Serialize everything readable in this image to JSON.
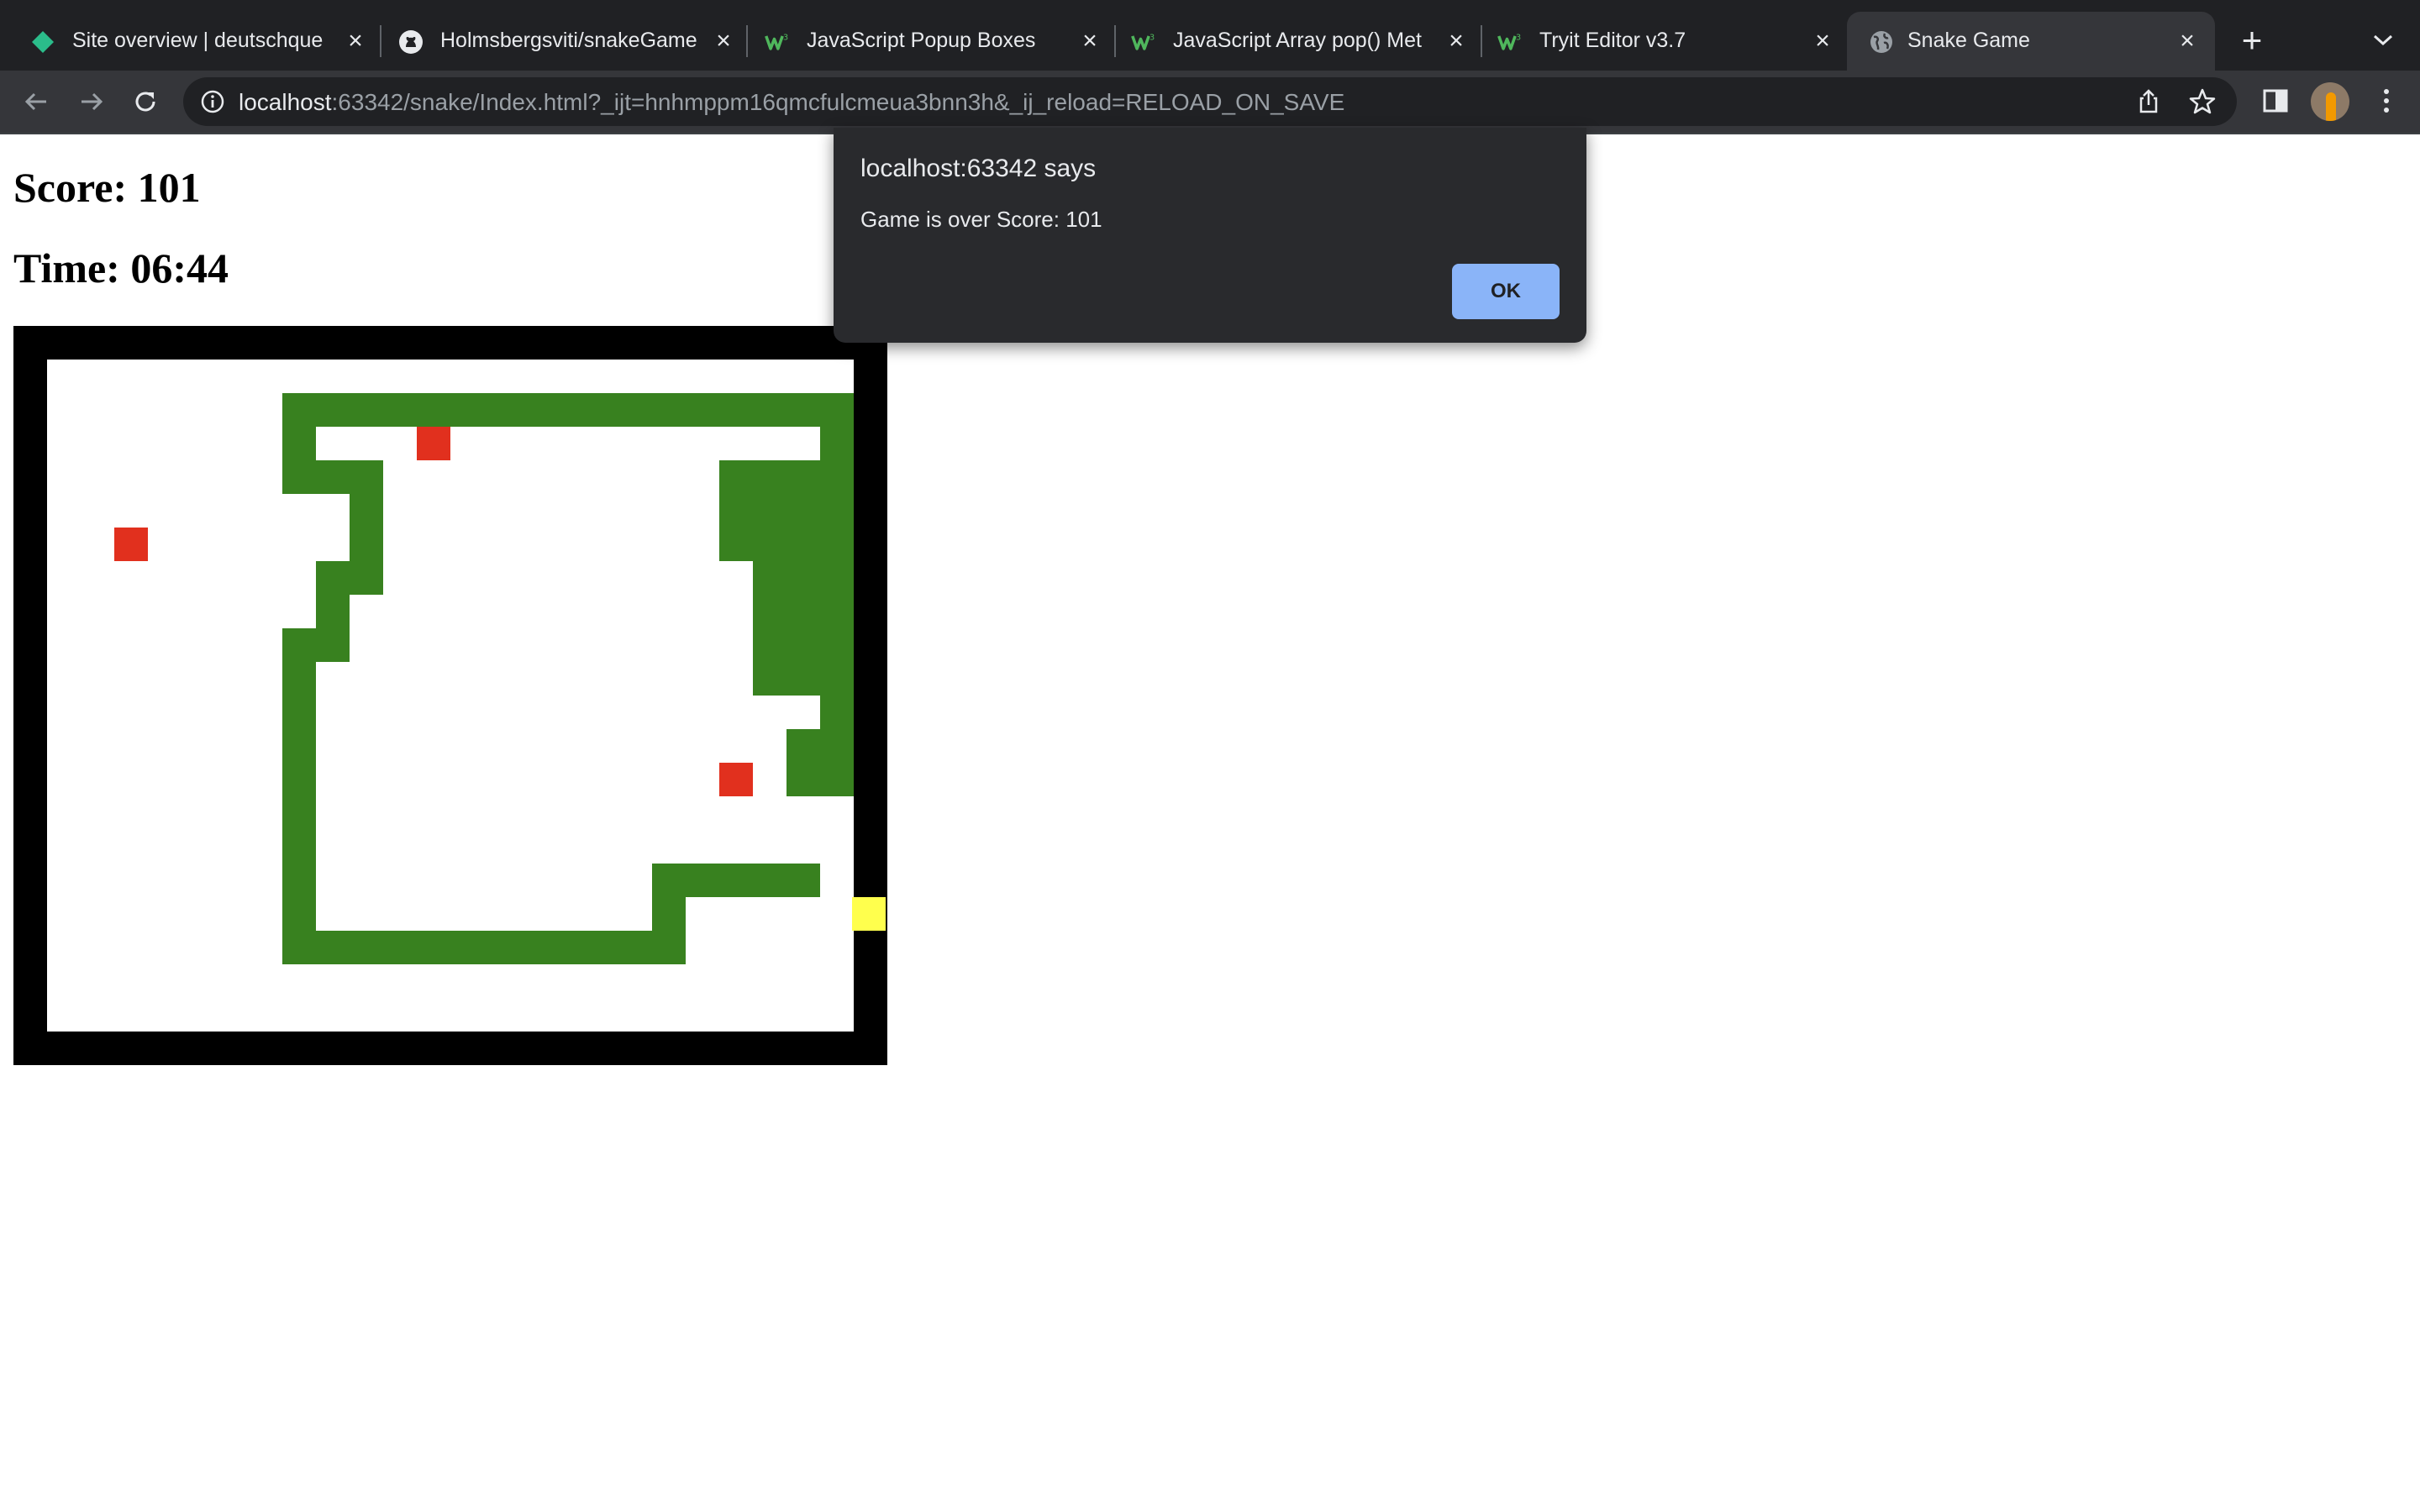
{
  "browser": {
    "tabs": [
      {
        "title": "Site overview | deutschque",
        "icon": "diamond-favicon-icon",
        "active": false
      },
      {
        "title": "Holmsbergsviti/snakeGame",
        "icon": "github-icon",
        "active": false
      },
      {
        "title": "JavaScript Popup Boxes",
        "icon": "w3schools-icon",
        "active": false
      },
      {
        "title": "JavaScript Array pop() Met",
        "icon": "w3schools-icon",
        "active": false
      },
      {
        "title": "Tryit Editor v3.7",
        "icon": "w3schools-icon",
        "active": false
      },
      {
        "title": "Snake Game",
        "icon": "globe-icon",
        "active": true
      }
    ],
    "address": {
      "host": "localhost",
      "rest": ":63342/snake/Index.html?_ijt=hnhmppm16qmcfulcmeua3bnn3h&_ij_reload=RELOAD_ON_SAVE"
    }
  },
  "page": {
    "score_text": "Score: 101",
    "time_text": "Time: 06:44"
  },
  "game": {
    "grid_columns": 24,
    "grid_rows": 20,
    "colors": {
      "frame": "#000000",
      "board": "#ffffff",
      "snake": "#38811f",
      "food": "#e1301e",
      "head": "#ffff4d"
    },
    "head": [
      24,
      16
    ],
    "food": [
      [
        2,
        5
      ],
      [
        11,
        2
      ],
      [
        20,
        12
      ]
    ],
    "snake_runs": [
      [
        1,
        7,
        23
      ],
      [
        2,
        7,
        7
      ],
      [
        2,
        23,
        23
      ],
      [
        3,
        7,
        9
      ],
      [
        3,
        20,
        23
      ],
      [
        4,
        9,
        9
      ],
      [
        4,
        20,
        23
      ],
      [
        5,
        9,
        9
      ],
      [
        5,
        20,
        23
      ],
      [
        6,
        8,
        9
      ],
      [
        6,
        21,
        23
      ],
      [
        7,
        8,
        8
      ],
      [
        7,
        21,
        23
      ],
      [
        8,
        7,
        8
      ],
      [
        8,
        21,
        23
      ],
      [
        9,
        7,
        7
      ],
      [
        9,
        21,
        23
      ],
      [
        10,
        7,
        7
      ],
      [
        10,
        23,
        23
      ],
      [
        11,
        7,
        7
      ],
      [
        11,
        22,
        23
      ],
      [
        12,
        7,
        7
      ],
      [
        12,
        22,
        23
      ],
      [
        13,
        7,
        7
      ],
      [
        14,
        7,
        7
      ],
      [
        15,
        7,
        7
      ],
      [
        15,
        18,
        22
      ],
      [
        16,
        7,
        7
      ],
      [
        16,
        18,
        18
      ],
      [
        17,
        7,
        18
      ]
    ]
  },
  "dialog": {
    "title": "localhost:63342 says",
    "message": "Game is over Score: 101",
    "ok_label": "OK"
  }
}
